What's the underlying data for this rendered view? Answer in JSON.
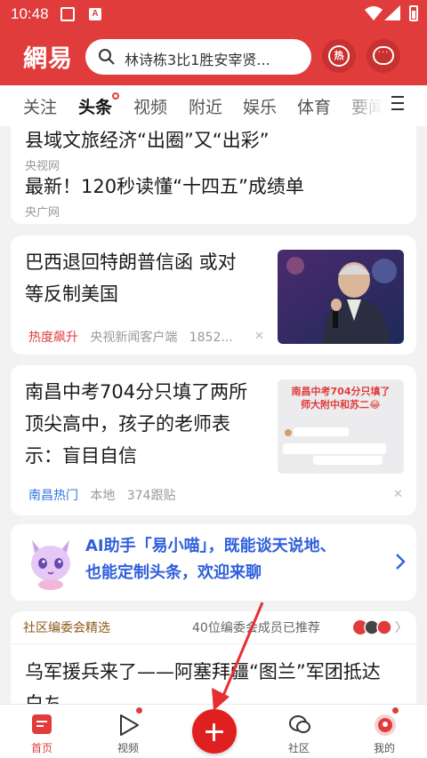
{
  "status_bar": {
    "time": "10:48",
    "notif_letter": "A"
  },
  "header": {
    "logo": "網易",
    "search_placeholder": "林诗栋3比1胜安宰贤...",
    "hot_label": "热",
    "message_label": "···"
  },
  "tabs": [
    {
      "label": "关注"
    },
    {
      "label": "头条"
    },
    {
      "label": "视频"
    },
    {
      "label": "附近"
    },
    {
      "label": "娱乐"
    },
    {
      "label": "体育"
    },
    {
      "label": "要闻"
    }
  ],
  "feed": {
    "card1": {
      "items": [
        {
          "title": "县域文旅经济“出圈”又“出彩”",
          "source": "央视网"
        },
        {
          "title": "最新！120秒读懂“十四五”成绩单",
          "source": "央广网"
        }
      ]
    },
    "card2": {
      "title_line1": "巴西退回特朗普信函 或对",
      "title_line2": "等反制美国",
      "tag": "热度飙升",
      "source": "央视新闻客户端",
      "count": "1852..."
    },
    "card3": {
      "title_line1": "南昌中考704分只填了两所",
      "title_line2": "顶尖高中，孩子的老师表",
      "title_line3": "示：盲目自信",
      "tag": "南昌热门",
      "location": "本地",
      "follows": "374跟贴",
      "thumb_caption_line1": "南昌中考704分只填了",
      "thumb_caption_line2": "师大附中和苏二😂"
    },
    "ai_card": {
      "line1": "AI助手「易小喵」，既能谈天说地、",
      "line2": "也能定制头条，欢迎来聊"
    },
    "community": {
      "header_left": "社区编委会精选",
      "header_right": "40位编委会成员已推荐",
      "title_line1": "乌军援兵来了——阿塞拜疆“图兰”军团抵达",
      "title_line2": "白ち"
    }
  },
  "bottom_nav": [
    {
      "label": "首页"
    },
    {
      "label": "视频"
    },
    {
      "label": "社区"
    },
    {
      "label": "我的"
    }
  ],
  "colors": {
    "brand_red": "#e03c3b",
    "link_blue": "#2f5fdc"
  }
}
